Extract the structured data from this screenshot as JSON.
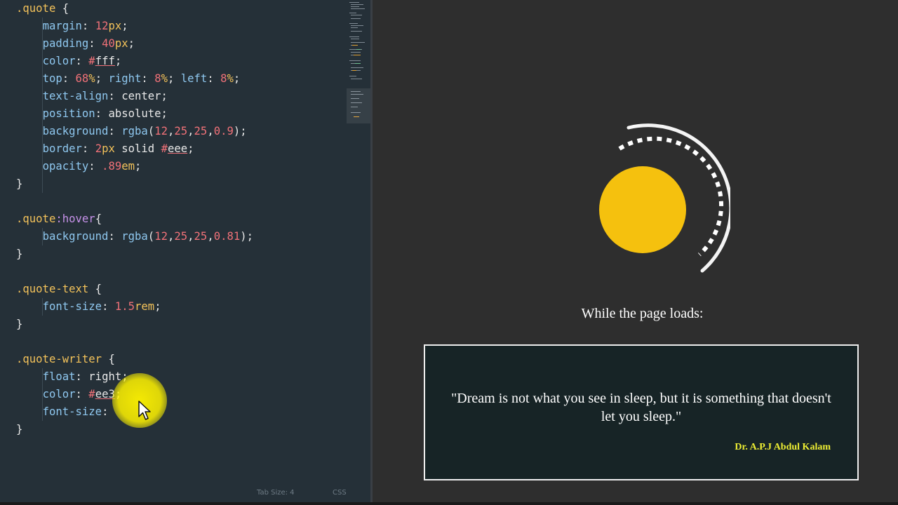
{
  "editor": {
    "code_lines": [
      [
        {
          "c": "selector",
          "t": ".quote"
        },
        {
          "c": "plain",
          "t": " {"
        }
      ],
      [
        {
          "c": "plain",
          "t": "    "
        },
        {
          "c": "prop",
          "t": "margin"
        },
        {
          "c": "plain",
          "t": ": "
        },
        {
          "c": "num",
          "t": "12"
        },
        {
          "c": "unit",
          "t": "px"
        },
        {
          "c": "plain",
          "t": ";"
        }
      ],
      [
        {
          "c": "plain",
          "t": "    "
        },
        {
          "c": "prop",
          "t": "padding"
        },
        {
          "c": "plain",
          "t": ": "
        },
        {
          "c": "num",
          "t": "40"
        },
        {
          "c": "unit",
          "t": "px"
        },
        {
          "c": "plain",
          "t": ";"
        }
      ],
      [
        {
          "c": "plain",
          "t": "    "
        },
        {
          "c": "prop",
          "t": "color"
        },
        {
          "c": "plain",
          "t": ": "
        },
        {
          "c": "hash",
          "t": "#"
        },
        {
          "c": "hexval",
          "t": "fff"
        },
        {
          "c": "plain",
          "t": ";"
        }
      ],
      [
        {
          "c": "plain",
          "t": "    "
        },
        {
          "c": "prop",
          "t": "top"
        },
        {
          "c": "plain",
          "t": ": "
        },
        {
          "c": "num",
          "t": "68"
        },
        {
          "c": "unit",
          "t": "%"
        },
        {
          "c": "plain",
          "t": "; "
        },
        {
          "c": "prop",
          "t": "right"
        },
        {
          "c": "plain",
          "t": ": "
        },
        {
          "c": "num",
          "t": "8"
        },
        {
          "c": "unit",
          "t": "%"
        },
        {
          "c": "plain",
          "t": "; "
        },
        {
          "c": "prop",
          "t": "left"
        },
        {
          "c": "plain",
          "t": ": "
        },
        {
          "c": "num",
          "t": "8"
        },
        {
          "c": "unit",
          "t": "%"
        },
        {
          "c": "plain",
          "t": ";"
        }
      ],
      [
        {
          "c": "plain",
          "t": "    "
        },
        {
          "c": "prop",
          "t": "text-align"
        },
        {
          "c": "plain",
          "t": ": center;"
        }
      ],
      [
        {
          "c": "plain",
          "t": "    "
        },
        {
          "c": "prop",
          "t": "position"
        },
        {
          "c": "plain",
          "t": ": absolute;"
        }
      ],
      [
        {
          "c": "plain",
          "t": "    "
        },
        {
          "c": "prop",
          "t": "background"
        },
        {
          "c": "plain",
          "t": ": "
        },
        {
          "c": "func",
          "t": "rgba"
        },
        {
          "c": "plain",
          "t": "("
        },
        {
          "c": "num",
          "t": "12"
        },
        {
          "c": "plain",
          "t": ","
        },
        {
          "c": "num",
          "t": "25"
        },
        {
          "c": "plain",
          "t": ","
        },
        {
          "c": "num",
          "t": "25"
        },
        {
          "c": "plain",
          "t": ","
        },
        {
          "c": "num",
          "t": "0.9"
        },
        {
          "c": "plain",
          "t": ");"
        }
      ],
      [
        {
          "c": "plain",
          "t": "    "
        },
        {
          "c": "prop",
          "t": "border"
        },
        {
          "c": "plain",
          "t": ": "
        },
        {
          "c": "num",
          "t": "2"
        },
        {
          "c": "unit",
          "t": "px"
        },
        {
          "c": "plain",
          "t": " solid "
        },
        {
          "c": "hash",
          "t": "#"
        },
        {
          "c": "hexval",
          "t": "eee"
        },
        {
          "c": "plain",
          "t": ";"
        }
      ],
      [
        {
          "c": "plain",
          "t": "    "
        },
        {
          "c": "prop",
          "t": "opacity"
        },
        {
          "c": "plain",
          "t": ": "
        },
        {
          "c": "num",
          "t": ".89"
        },
        {
          "c": "unit",
          "t": "em"
        },
        {
          "c": "plain",
          "t": ";"
        }
      ],
      [
        {
          "c": "plain",
          "t": "}"
        }
      ],
      [],
      [
        {
          "c": "selector",
          "t": ".quote"
        },
        {
          "c": "pseudo",
          "t": ":hover"
        },
        {
          "c": "plain",
          "t": "{"
        }
      ],
      [
        {
          "c": "plain",
          "t": "    "
        },
        {
          "c": "prop",
          "t": "background"
        },
        {
          "c": "plain",
          "t": ": "
        },
        {
          "c": "func",
          "t": "rgba"
        },
        {
          "c": "plain",
          "t": "("
        },
        {
          "c": "num",
          "t": "12"
        },
        {
          "c": "plain",
          "t": ","
        },
        {
          "c": "num",
          "t": "25"
        },
        {
          "c": "plain",
          "t": ","
        },
        {
          "c": "num",
          "t": "25"
        },
        {
          "c": "plain",
          "t": ","
        },
        {
          "c": "num",
          "t": "0.81"
        },
        {
          "c": "plain",
          "t": ");"
        }
      ],
      [
        {
          "c": "plain",
          "t": "}"
        }
      ],
      [],
      [
        {
          "c": "selector",
          "t": ".quote-text"
        },
        {
          "c": "plain",
          "t": " {"
        }
      ],
      [
        {
          "c": "plain",
          "t": "    "
        },
        {
          "c": "prop",
          "t": "font-size"
        },
        {
          "c": "plain",
          "t": ": "
        },
        {
          "c": "num",
          "t": "1.5"
        },
        {
          "c": "unit",
          "t": "rem"
        },
        {
          "c": "plain",
          "t": ";"
        }
      ],
      [
        {
          "c": "plain",
          "t": "}"
        }
      ],
      [],
      [
        {
          "c": "selector",
          "t": ".quote-writer"
        },
        {
          "c": "plain",
          "t": " {"
        }
      ],
      [
        {
          "c": "plain",
          "t": "    "
        },
        {
          "c": "prop",
          "t": "float"
        },
        {
          "c": "plain",
          "t": ": right;"
        }
      ],
      [
        {
          "c": "plain",
          "t": "    "
        },
        {
          "c": "prop",
          "t": "color"
        },
        {
          "c": "plain",
          "t": ": "
        },
        {
          "c": "hash",
          "t": "#"
        },
        {
          "c": "hexval",
          "t": "ee3"
        },
        {
          "c": "plain",
          "t": ";"
        }
      ],
      [
        {
          "c": "plain",
          "t": "    "
        },
        {
          "c": "prop",
          "t": "font-size"
        },
        {
          "c": "plain",
          "t": ": "
        }
      ],
      [
        {
          "c": "plain",
          "t": "}"
        }
      ]
    ],
    "status": {
      "tab_size": "Tab Size: 4",
      "syntax": "CSS"
    }
  },
  "preview": {
    "loading_text": "While the page loads:",
    "quote_text": "\"Dream is not what you see in sleep, but it is something that doesn't let you sleep.\"",
    "quote_writer": "Dr. A.P.J Abdul Kalam",
    "colors": {
      "background": "#2e2e2e",
      "sun": "#f5c10e",
      "quote_bg": "#172426",
      "writer": "#eeee33"
    }
  },
  "icons": [
    "mouse-cursor-icon",
    "loader-spinner-icon"
  ]
}
